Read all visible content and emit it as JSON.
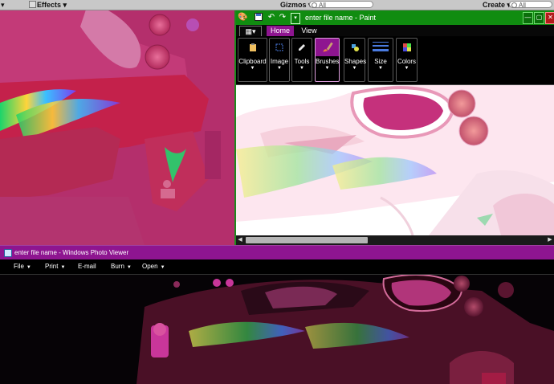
{
  "unity_bar": {
    "effects_label": "Effects",
    "gizmos_label": "Gizmos",
    "search_left_placeholder": "All",
    "create_label": "Create",
    "search_right_placeholder": "All"
  },
  "paint": {
    "title": "enter file name - Paint",
    "tabs": [
      {
        "label": "Home"
      },
      {
        "label": "View"
      }
    ],
    "groups": [
      {
        "label": "Clipboard"
      },
      {
        "label": "Image"
      },
      {
        "label": "Tools"
      },
      {
        "label": "Brushes"
      },
      {
        "label": "Shapes"
      },
      {
        "label": "Size"
      },
      {
        "label": "Colors"
      }
    ],
    "colors": {
      "title_bar": "#108c10",
      "active_tab": "#8e1590",
      "selected_group": "#8e1590"
    }
  },
  "photo_viewer": {
    "title": "enter file name - Windows Photo Viewer",
    "menu": [
      {
        "label": "File"
      },
      {
        "label": "Print"
      },
      {
        "label": "E-mail"
      },
      {
        "label": "Burn"
      },
      {
        "label": "Open"
      }
    ],
    "colors": {
      "title_bar": "#8e1590"
    }
  }
}
